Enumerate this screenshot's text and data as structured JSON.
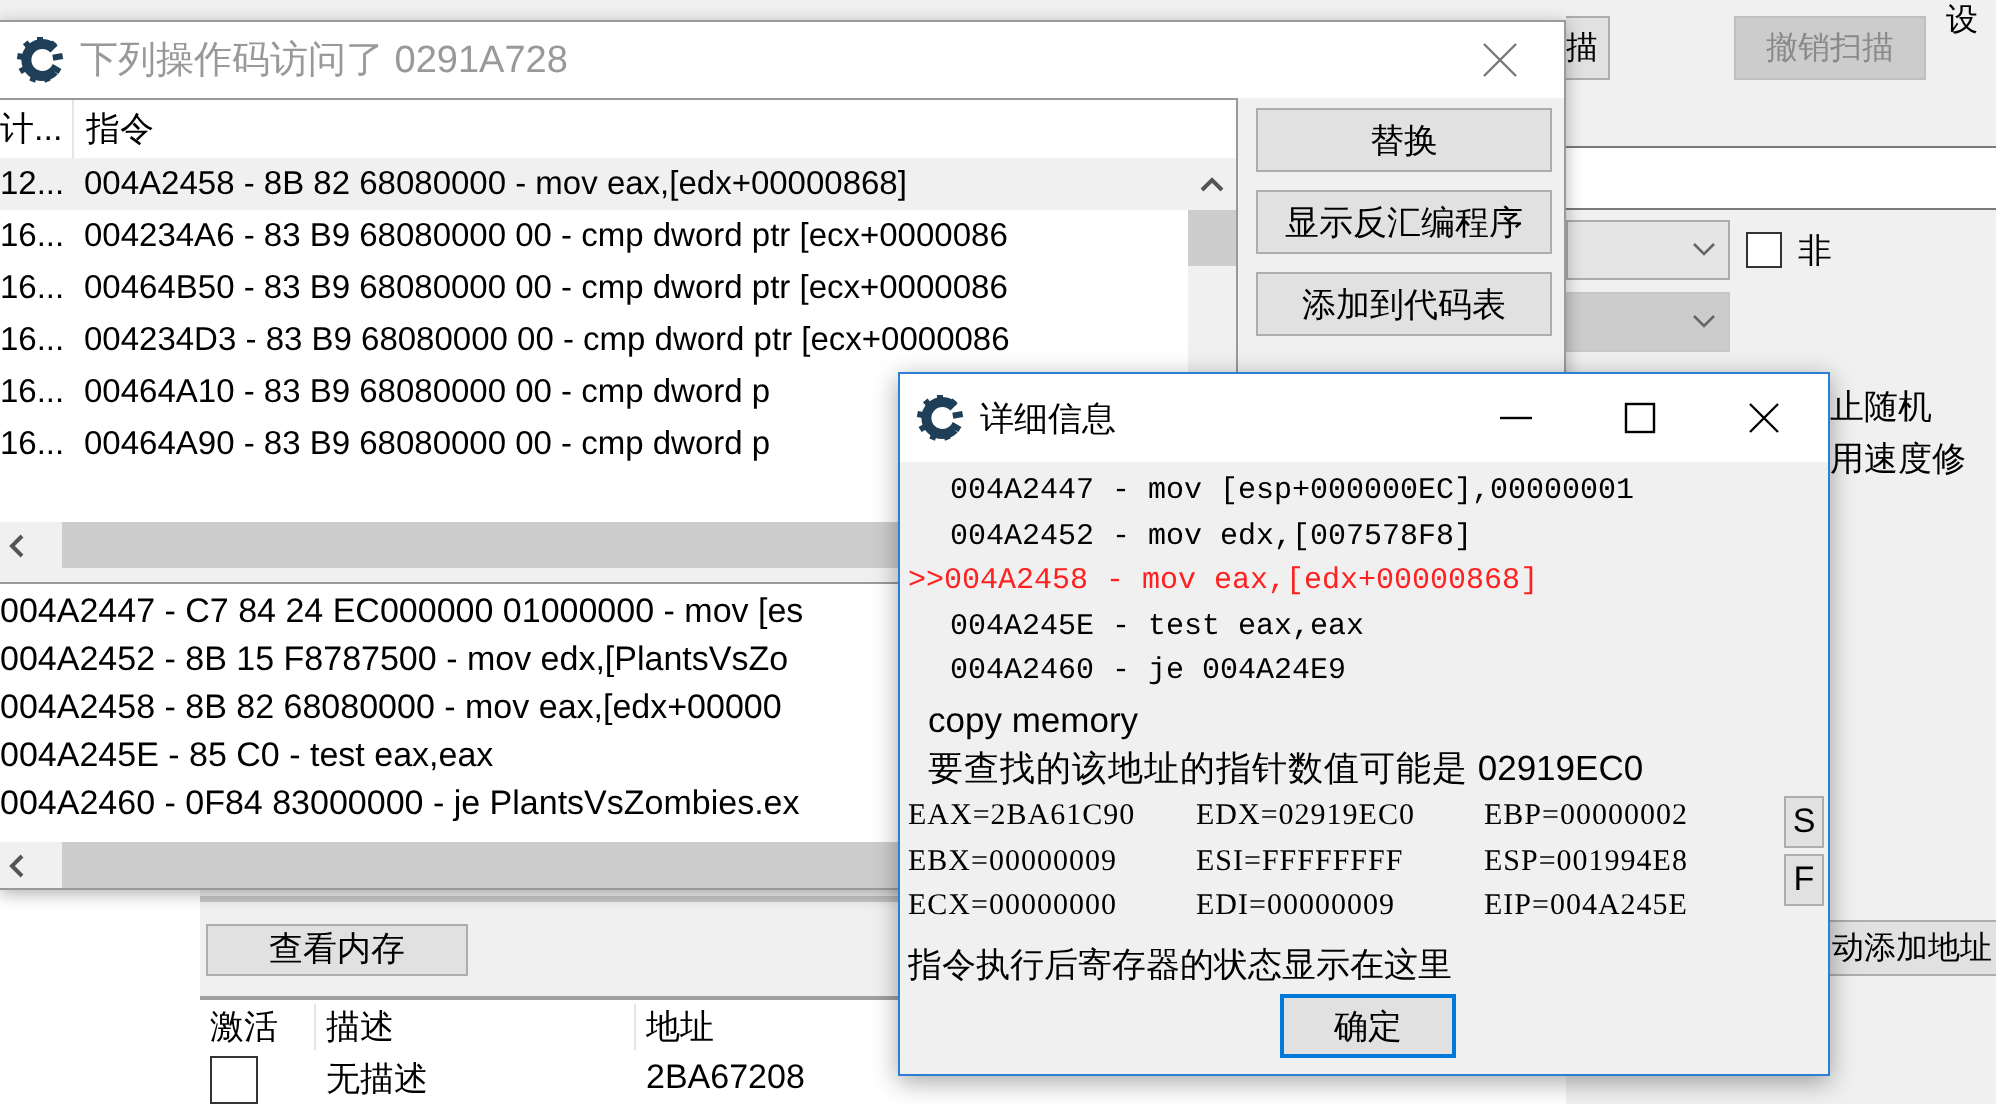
{
  "main_window": {
    "scan_button": "描",
    "undo_scan_button": {
      "label": "撤销扫描",
      "disabled": true
    },
    "settings_text": "设",
    "dropdowns": [
      {
        "disabled": false
      },
      {
        "disabled": true
      }
    ],
    "not_option": {
      "label": "非",
      "checked": false
    },
    "options": [
      "止随机",
      "用速度修"
    ],
    "add_address_button": "动添加地址",
    "view_memory_button": "查看内存",
    "address_table": {
      "columns": [
        "激活",
        "描述",
        "地址"
      ],
      "rows": [
        {
          "active": false,
          "description": "无描述",
          "address": "2BA67208"
        }
      ]
    }
  },
  "opcode_window": {
    "title": "下列操作码访问了 0291A728",
    "columns": [
      "计...",
      "指令"
    ],
    "rows": [
      {
        "count": "12...",
        "instruction": "004A2458 - 8B 82 68080000  - mov eax,[edx+00000868]",
        "selected": true
      },
      {
        "count": "16...",
        "instruction": "004234A6 - 83 B9 68080000 00 - cmp dword ptr [ecx+0000086",
        "selected": false
      },
      {
        "count": "16...",
        "instruction": "00464B50 - 83 B9 68080000 00 - cmp dword ptr [ecx+0000086",
        "selected": false
      },
      {
        "count": "16...",
        "instruction": "004234D3 - 83 B9 68080000 00 - cmp dword ptr [ecx+0000086",
        "selected": false
      },
      {
        "count": "16...",
        "instruction": "00464A10 - 83 B9 68080000 00 - cmp dword p",
        "selected": false
      },
      {
        "count": "16...",
        "instruction": "00464A90 - 83 B9 68080000 00 - cmp dword p",
        "selected": false
      }
    ],
    "buttons": [
      "替换",
      "显示反汇编程序",
      "添加到代码表"
    ],
    "disassembly": [
      "004A2447 - C7 84 24 EC000000 01000000 - mov [es",
      "004A2452 - 8B 15 F8787500  - mov edx,[PlantsVsZo",
      "004A2458 - 8B 82 68080000  - mov eax,[edx+00000",
      "004A245E - 85 C0  - test eax,eax",
      "004A2460 - 0F84 83000000 - je PlantsVsZombies.ex"
    ]
  },
  "detail_window": {
    "title": "详细信息",
    "current_marker": ">>",
    "code_lines": [
      {
        "text": "004A2447 - mov [esp+000000EC],00000001",
        "current": false
      },
      {
        "text": "004A2452 - mov edx,[007578F8]",
        "current": false
      },
      {
        "text": "004A2458 - mov eax,[edx+00000868]",
        "current": true
      },
      {
        "text": "004A245E - test eax,eax",
        "current": false
      },
      {
        "text": "004A2460 - je 004A24E9",
        "current": false
      }
    ],
    "note": "copy memory",
    "pointer_hint": "要查找的该地址的指针数值可能是 02919EC0",
    "registers": [
      "EAX=2BA61C90",
      "EDX=02919EC0",
      "EBP=00000002",
      "EBX=00000009",
      "ESI=FFFFFFFF",
      "ESP=001994E8",
      "ECX=00000000",
      "EDI=00000009",
      "EIP=004A245E"
    ],
    "side_buttons": [
      "S",
      "F"
    ],
    "footer": "指令执行后寄存器的状态显示在这里",
    "ok_button": "确定"
  }
}
